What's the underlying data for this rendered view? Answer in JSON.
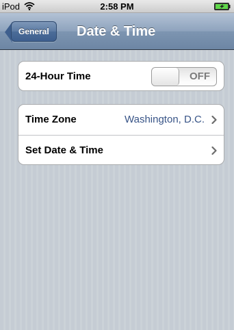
{
  "status_bar": {
    "carrier": "iPod",
    "time": "2:58 PM",
    "wifi_icon": "wifi-icon",
    "battery_icon": "battery-charging-icon"
  },
  "nav_bar": {
    "back_label": "General",
    "title": "Date & Time"
  },
  "groups": {
    "hour24": {
      "label": "24-Hour Time",
      "toggle_text": "OFF",
      "toggle_on": false
    },
    "time_zone": {
      "label": "Time Zone",
      "value": "Washington, D.C.",
      "chevron_icon": "chevron-right-icon"
    },
    "set_date_time": {
      "label": "Set Date & Time",
      "chevron_icon": "chevron-right-icon"
    }
  },
  "colors": {
    "background": "#c5ccd4",
    "nav_bar": "#6d86a4",
    "value_text": "#385487",
    "toggle_off_text": "#7b7b7b"
  }
}
